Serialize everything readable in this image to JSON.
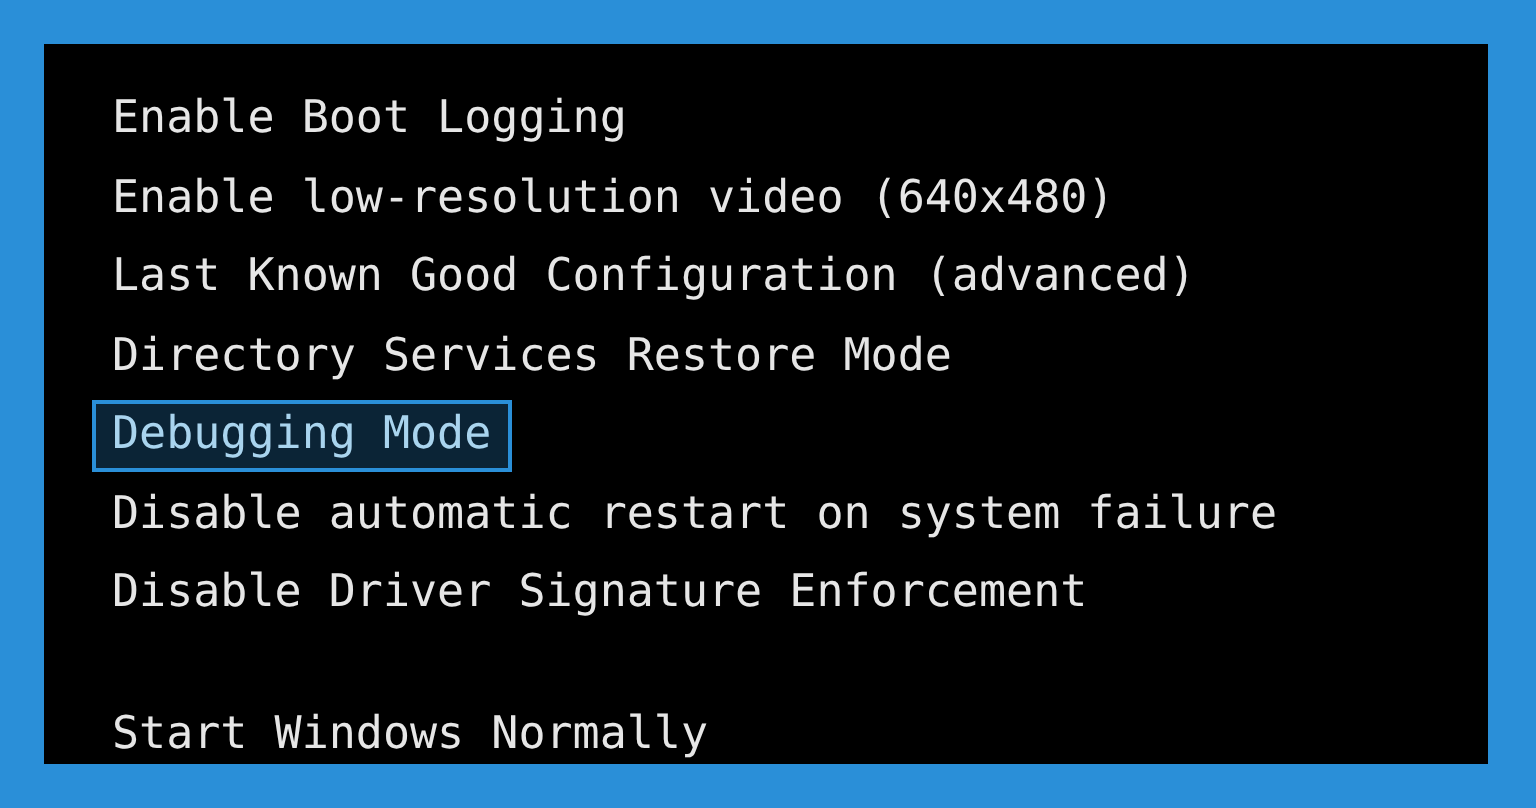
{
  "menu_groups": [
    {
      "options": [
        {
          "label": "Enable Boot Logging",
          "selected": false
        },
        {
          "label": "Enable low-resolution video (640x480)",
          "selected": false
        },
        {
          "label": "Last Known Good Configuration (advanced)",
          "selected": false
        },
        {
          "label": "Directory Services Restore Mode",
          "selected": false
        },
        {
          "label": "Debugging Mode",
          "selected": true
        },
        {
          "label": "Disable automatic restart on system failure",
          "selected": false
        },
        {
          "label": "Disable Driver Signature Enforcement",
          "selected": false
        }
      ]
    },
    {
      "options": [
        {
          "label": "Start Windows Normally",
          "selected": false
        }
      ]
    }
  ]
}
